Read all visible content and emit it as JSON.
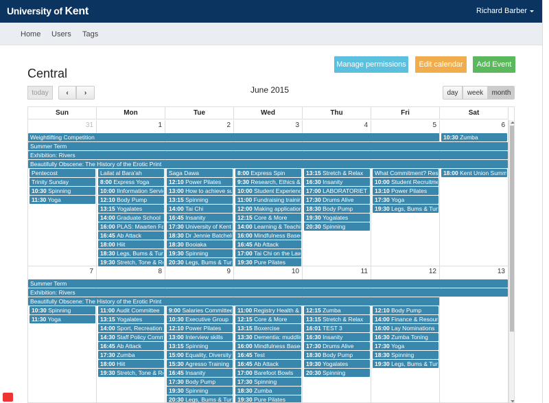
{
  "header": {
    "brand_prefix": "University of ",
    "brand_name": "Kent",
    "user_name": "Richard Barber"
  },
  "nav": {
    "items": [
      "Home",
      "Users",
      "Tags"
    ]
  },
  "page": {
    "title": "Central",
    "buttons": {
      "manage_permissions": "Manage permissions",
      "edit_calendar": "Edit calendar",
      "add_event": "Add Event"
    }
  },
  "toolbar": {
    "today": "today",
    "prev": "‹",
    "next": "›",
    "title": "June 2015",
    "views": {
      "day": "day",
      "week": "week",
      "month": "month"
    },
    "active_view": "month"
  },
  "calendar": {
    "days_of_week": [
      "Sun",
      "Mon",
      "Tue",
      "Wed",
      "Thu",
      "Fri",
      "Sat"
    ],
    "weeks": [
      {
        "dates": [
          "31",
          "1",
          "2",
          "3",
          "4",
          "5",
          "6"
        ],
        "other_month": [
          true,
          false,
          false,
          false,
          false,
          false,
          false
        ],
        "spanning": [
          {
            "title": "Weightlifting Competition",
            "start": 0,
            "end": 5,
            "row": 0
          },
          {
            "title": "Summer Term",
            "start": 0,
            "end": 6,
            "row": 1
          },
          {
            "title": "Exhibition: Rivers",
            "start": 0,
            "end": 6,
            "row": 2
          },
          {
            "title": "Beautifully Obscene: The History of the Erotic Print",
            "start": 0,
            "end": 6,
            "row": 3
          }
        ],
        "singles": [
          {
            "day": 6,
            "row": 0,
            "time": "10:30",
            "title": "Zumba"
          }
        ],
        "days": [
          [
            {
              "time": "",
              "title": "Pentecost"
            },
            {
              "time": "",
              "title": "Trinity Sunday"
            },
            {
              "time": "10:30",
              "title": "Spinning"
            },
            {
              "time": "11:30",
              "title": "Yoga"
            }
          ],
          [
            {
              "time": "",
              "title": "Lailat al Bara'ah"
            },
            {
              "time": "8:00",
              "title": "Express Yoga"
            },
            {
              "time": "10:00",
              "title": "IInformation Services"
            },
            {
              "time": "12:10",
              "title": "Body Pump"
            },
            {
              "time": "13:15",
              "title": "Yogalates"
            },
            {
              "time": "14:00",
              "title": "Graduate School"
            },
            {
              "time": "16:00",
              "title": "PLAS: Maarten Fa"
            },
            {
              "time": "16:45",
              "title": "Ab Attack"
            },
            {
              "time": "18:00",
              "title": "Hiit"
            },
            {
              "time": "18:30",
              "title": "Legs, Bums & Tums"
            },
            {
              "time": "19:30",
              "title": "Stretch, Tone & Relax"
            }
          ],
          [
            {
              "time": "",
              "title": "Saga Dawa"
            },
            {
              "time": "12:10",
              "title": "Power Pilates"
            },
            {
              "time": "13:00",
              "title": "How to achieve success"
            },
            {
              "time": "13:15",
              "title": "Spinning"
            },
            {
              "time": "14:00",
              "title": "Tai Chi"
            },
            {
              "time": "16:45",
              "title": "Insanity"
            },
            {
              "time": "17:30",
              "title": "University of Kent"
            },
            {
              "time": "18:30",
              "title": "Dr Jennie Batchelor"
            },
            {
              "time": "18:30",
              "title": "Booiaka"
            },
            {
              "time": "19:30",
              "title": "Spinning"
            },
            {
              "time": "20:30",
              "title": "Legs, Bums & Tums"
            }
          ],
          [
            {
              "time": "8:00",
              "title": "Express Spin"
            },
            {
              "time": "9:30",
              "title": "Research, Ethics &"
            },
            {
              "time": "10:00",
              "title": "Student Experience"
            },
            {
              "time": "11:00",
              "title": "Fundraising training"
            },
            {
              "time": "12:00",
              "title": "Making applications"
            },
            {
              "time": "12:15",
              "title": "Core & More"
            },
            {
              "time": "14:00",
              "title": "Learning & Teaching"
            },
            {
              "time": "16:00",
              "title": "Mindfulness Based"
            },
            {
              "time": "16:45",
              "title": "Ab Attack"
            },
            {
              "time": "17:00",
              "title": "Tai Chi on the Lawn"
            },
            {
              "time": "19:30",
              "title": "Pure Pilates"
            }
          ],
          [
            {
              "time": "13:15",
              "title": "Stretch & Relax"
            },
            {
              "time": "16:30",
              "title": "Insanity"
            },
            {
              "time": "17:00",
              "title": "LABORATORIET"
            },
            {
              "time": "17:30",
              "title": "Drums Alive"
            },
            {
              "time": "18:30",
              "title": "Body Pump"
            },
            {
              "time": "19:30",
              "title": "Yogalates"
            },
            {
              "time": "20:30",
              "title": "Spinning"
            }
          ],
          [
            {
              "time": "",
              "title": "What Commitment? Research"
            },
            {
              "time": "10:00",
              "title": "Student Recruitment"
            },
            {
              "time": "13:10",
              "title": "Power Pilates"
            },
            {
              "time": "17:30",
              "title": "Yoga"
            },
            {
              "time": "19:30",
              "title": "Legs, Bums & Tums"
            }
          ],
          [
            {
              "time": "18:00",
              "title": "Kent Union Summer"
            }
          ]
        ]
      },
      {
        "dates": [
          "7",
          "8",
          "9",
          "10",
          "11",
          "12",
          "13"
        ],
        "other_month": [
          false,
          false,
          false,
          false,
          false,
          false,
          false
        ],
        "spanning": [
          {
            "title": "Summer Term",
            "start": 0,
            "end": 6,
            "row": 0
          },
          {
            "title": "Exhibition: Rivers",
            "start": 0,
            "end": 6,
            "row": 1
          },
          {
            "title": "Beautifully Obscene: The History of the Erotic Print",
            "start": 0,
            "end": 5,
            "row": 2
          }
        ],
        "singles": [],
        "days": [
          [
            {
              "time": "10:30",
              "title": "Spinning"
            },
            {
              "time": "11:30",
              "title": "Yoga"
            }
          ],
          [
            {
              "time": "11:00",
              "title": "Audit Committee"
            },
            {
              "time": "13:15",
              "title": "Yogalates"
            },
            {
              "time": "14:00",
              "title": "Sport, Recreation"
            },
            {
              "time": "14:30",
              "title": "Staff Policy Committee"
            },
            {
              "time": "16:45",
              "title": "Ab Attack"
            },
            {
              "time": "17:30",
              "title": "Zumba"
            },
            {
              "time": "18:00",
              "title": "Hiit"
            },
            {
              "time": "19:30",
              "title": "Stretch, Tone & Relax"
            }
          ],
          [
            {
              "time": "9:00",
              "title": "Salaries Committee"
            },
            {
              "time": "10:30",
              "title": "Executive Group"
            },
            {
              "time": "12:10",
              "title": "Power Pilates"
            },
            {
              "time": "13:00",
              "title": "Interview skills"
            },
            {
              "time": "13:15",
              "title": "Spinning"
            },
            {
              "time": "15:00",
              "title": "Equality, Diversity"
            },
            {
              "time": "15:30",
              "title": "Agresso Training"
            },
            {
              "time": "16:45",
              "title": "Insanity"
            },
            {
              "time": "17:30",
              "title": "Body Pump"
            },
            {
              "time": "19:30",
              "title": "Spinning"
            },
            {
              "time": "20:30",
              "title": "Legs, Bums & Tums"
            }
          ],
          [
            {
              "time": "11:00",
              "title": "Registry Health &"
            },
            {
              "time": "12:15",
              "title": "Core & More"
            },
            {
              "time": "13:15",
              "title": "Boxercise"
            },
            {
              "time": "13:30",
              "title": "Dementia: muddling"
            },
            {
              "time": "16:00",
              "title": "Mindfulness Based"
            },
            {
              "time": "16:45",
              "title": "Test"
            },
            {
              "time": "16:45",
              "title": "Ab Attack"
            },
            {
              "time": "17:00",
              "title": "Barefoot Bowls"
            },
            {
              "time": "17:30",
              "title": "Spinning"
            },
            {
              "time": "18:30",
              "title": "Zumba"
            },
            {
              "time": "19:30",
              "title": "Pure Pilates"
            }
          ],
          [
            {
              "time": "12:15",
              "title": "Zumba"
            },
            {
              "time": "13:15",
              "title": "Stretch & Relax"
            },
            {
              "time": "16:01",
              "title": "TEST 3"
            },
            {
              "time": "16:30",
              "title": "Insanity"
            },
            {
              "time": "17:30",
              "title": "Drums Alive"
            },
            {
              "time": "18:30",
              "title": "Body Pump"
            },
            {
              "time": "19:30",
              "title": "Yogalates"
            },
            {
              "time": "20:30",
              "title": "Spinning"
            }
          ],
          [
            {
              "time": "12:10",
              "title": "Body Pump"
            },
            {
              "time": "14:00",
              "title": "Finance & Resources"
            },
            {
              "time": "16:00",
              "title": "Lay Nominations"
            },
            {
              "time": "16:30",
              "title": "Zumba Toning"
            },
            {
              "time": "17:30",
              "title": "Yoga"
            },
            {
              "time": "18:30",
              "title": "Spinning"
            },
            {
              "time": "19:30",
              "title": "Legs, Bums & Tums"
            }
          ],
          []
        ]
      }
    ]
  },
  "colors": {
    "event": "#3a87ad",
    "topbar": "#0b3460",
    "info": "#5bc0de",
    "warning": "#f0ad4e",
    "success": "#5cb85c"
  }
}
